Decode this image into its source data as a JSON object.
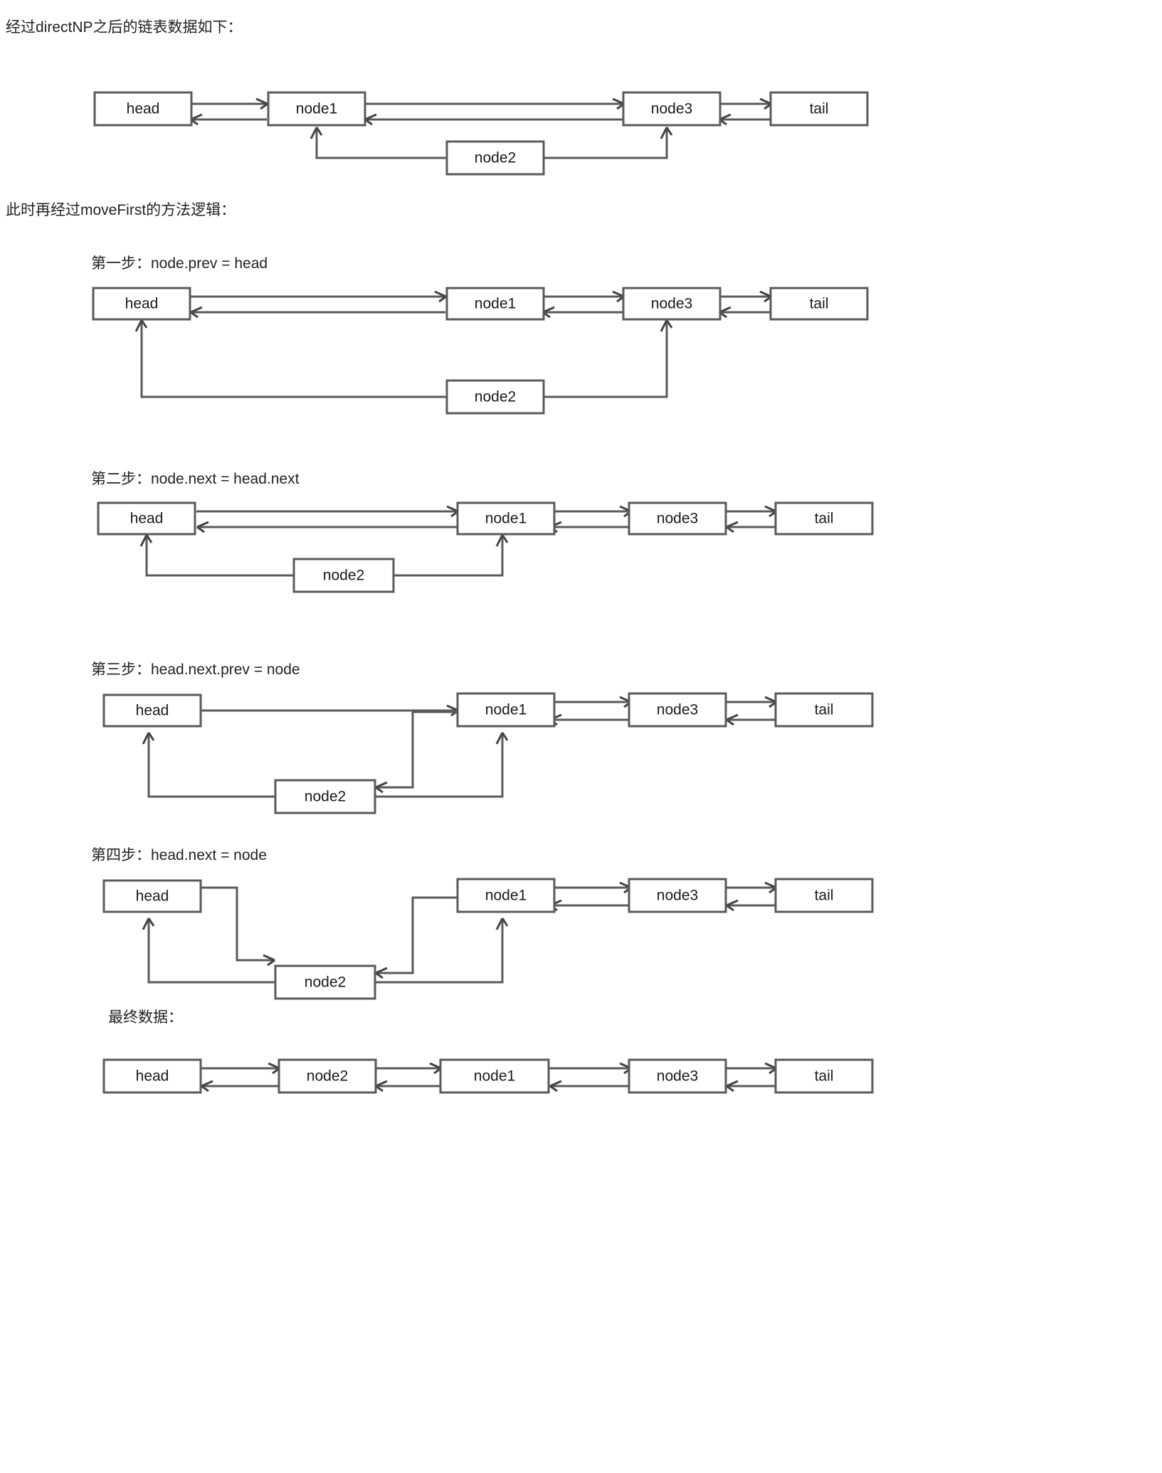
{
  "page": {
    "intro_text": "经过directNP之后的链表数据如下：",
    "second_text": "此时再经过moveFirst的方法逻辑："
  },
  "node_labels": {
    "head": "head",
    "node1": "node1",
    "node2": "node2",
    "node3": "node3",
    "tail": "tail"
  },
  "sections": [
    {
      "id": "intro-diagram",
      "caption": "经过directNP之后的链表数据如下：",
      "boxes": [
        "head",
        "node1",
        "node3",
        "tail",
        "node2"
      ]
    },
    {
      "id": "step-1",
      "caption": "第一步：node.prev = head",
      "boxes": [
        "head",
        "node1",
        "node3",
        "tail",
        "node2"
      ]
    },
    {
      "id": "step-2",
      "caption": "第二步：node.next = head.next",
      "boxes": [
        "head",
        "node1",
        "node3",
        "tail",
        "node2"
      ]
    },
    {
      "id": "step-3",
      "caption": "第三步：head.next.prev = node",
      "boxes": [
        "head",
        "node1",
        "node3",
        "tail",
        "node2"
      ]
    },
    {
      "id": "step-4",
      "caption": "第四步：head.next = node",
      "boxes": [
        "head",
        "node1",
        "node3",
        "tail",
        "node2"
      ]
    },
    {
      "id": "final",
      "caption": "最终数据：",
      "boxes": [
        "head",
        "node2",
        "node1",
        "node3",
        "tail"
      ]
    }
  ],
  "captions": {
    "intro": "经过directNP之后的链表数据如下：",
    "movefirst": "此时再经过moveFirst的方法逻辑：",
    "step1": "第一步：node.prev = head",
    "step2": "第二步：node.next = head.next",
    "step3": "第三步：head.next.prev = node",
    "step4": "第四步：head.next = node",
    "final": "最终数据："
  },
  "colors": {
    "box_stroke": "#5a5a5a",
    "box_fill": "#ffffff",
    "edge": "#5a5a5a",
    "text": "#1a1a1a",
    "background": "#ffffff"
  }
}
